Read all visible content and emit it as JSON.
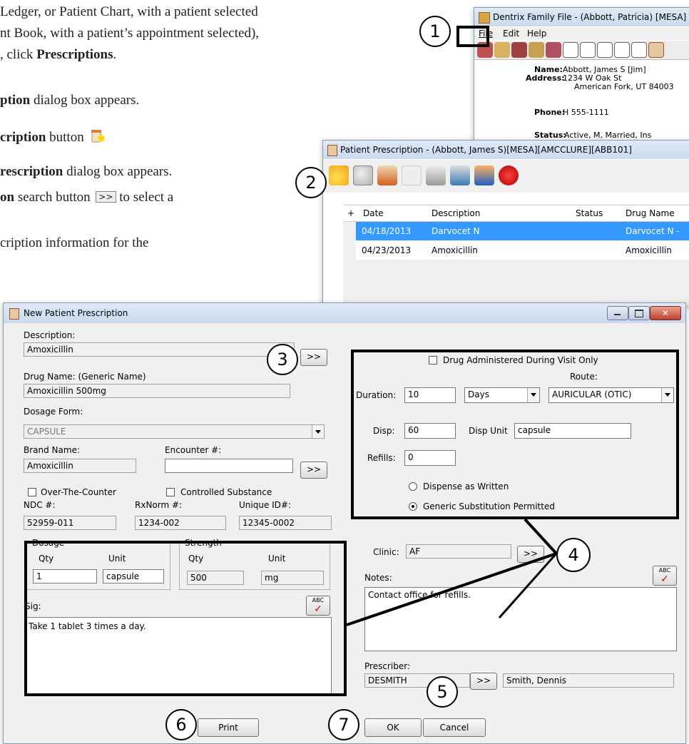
{
  "doc": {
    "line1": "Ledger, or Patient Chart, with a patient selected",
    "line2": "nt Book, with a patient’s appointment selected),",
    "line3_pre": ", click ",
    "line3_bold": "Prescriptions",
    "line3_post": ".",
    "line4_bold": "ption",
    "line4_post": " dialog box appears.",
    "line5_bold": "cription",
    "line5_post": " button",
    "line6_bold": "rescription",
    "line6_post": " dialog box appears.",
    "line7_bold": "on",
    "line7_post": " search button",
    "line7_end": " to select a",
    "line8": "cription information for the",
    "search_glyph": ">>"
  },
  "callouts": [
    "1",
    "2",
    "3",
    "4",
    "5",
    "6",
    "7"
  ],
  "family_file": {
    "title": "Dentrix Family File - (Abbott, Patricia) [MESA] [DDS",
    "menu": [
      "File",
      "Edit",
      "Help"
    ],
    "name_label": "Name:",
    "name_value": "Abbott, James S [Jim]",
    "address_label": "Address:",
    "address_line1": "1234 W Oak St",
    "address_line2": "American Fork, UT  84003",
    "phone_label": "Phone:",
    "phone_value": "H 555-1111",
    "status_label": "Status:",
    "status_value": "Active, M, Married, Ins"
  },
  "patient_rx": {
    "title": "Patient Prescription - (Abbott, James S)[MESA][AMCCLURE][ABB101]",
    "columns": [
      "+",
      "Date",
      "Description",
      "Status",
      "Drug Name"
    ],
    "rows": [
      {
        "date": "04/18/2013",
        "description": "Darvocet N",
        "status": "",
        "drug": "Darvocet N -"
      },
      {
        "date": "04/23/2013",
        "description": "Amoxicillin",
        "status": "",
        "drug": "Amoxicillin"
      }
    ]
  },
  "new_rx": {
    "title": "New Patient Prescription",
    "description_label": "Description:",
    "description_value": "Amoxicillin",
    "search_btn": ">>",
    "drug_name_label": "Drug Name: (Generic Name)",
    "drug_name_value": "Amoxicillin 500mg",
    "dosage_form_label": "Dosage Form:",
    "dosage_form_value": "CAPSULE",
    "brand_label": "Brand Name:",
    "brand_value": "Amoxicillin",
    "encounter_label": "Encounter #:",
    "encounter_value": "",
    "otc_label": "Over-The-Counter",
    "controlled_label": "Controlled Substance",
    "ndc_label": "NDC #:",
    "ndc_value": "52959-011",
    "rxnorm_label": "RxNorm #:",
    "rxnorm_value": "1234-002",
    "unique_label": "Unique ID#:",
    "unique_value": "12345-0002",
    "dosage_group": "Dosage",
    "strength_group": "Strength",
    "qty_label": "Qty",
    "unit_label": "Unit",
    "dosage_qty": "1",
    "dosage_unit": "capsule",
    "strength_qty": "500",
    "strength_unit": "mg",
    "sig_label": "Sig:",
    "sig_value": "Take 1 tablet 3 times a day.",
    "spell_icon": "ABC",
    "drug_admin_label": "Drug Administered During Visit Only",
    "route_label": "Route:",
    "route_value": "AURICULAR (OTIC)",
    "duration_label": "Duration:",
    "duration_value": "10",
    "duration_unit": "Days",
    "disp_label": "Disp:",
    "disp_value": "60",
    "disp_unit_label": "Disp Unit",
    "disp_unit_value": "capsule",
    "refills_label": "Refills:",
    "refills_value": "0",
    "daw_label": "Dispense as Written",
    "generic_label": "Generic Substitution Permitted",
    "clinic_label": "Clinic:",
    "clinic_value": "AF",
    "notes_label": "Notes:",
    "notes_value": "Contact office for refills.",
    "prescriber_label": "Prescriber:",
    "prescriber_id": "DESMITH",
    "prescriber_name": "Smith, Dennis",
    "print_btn": "Print",
    "ok_btn": "OK",
    "cancel_btn": "Cancel"
  }
}
